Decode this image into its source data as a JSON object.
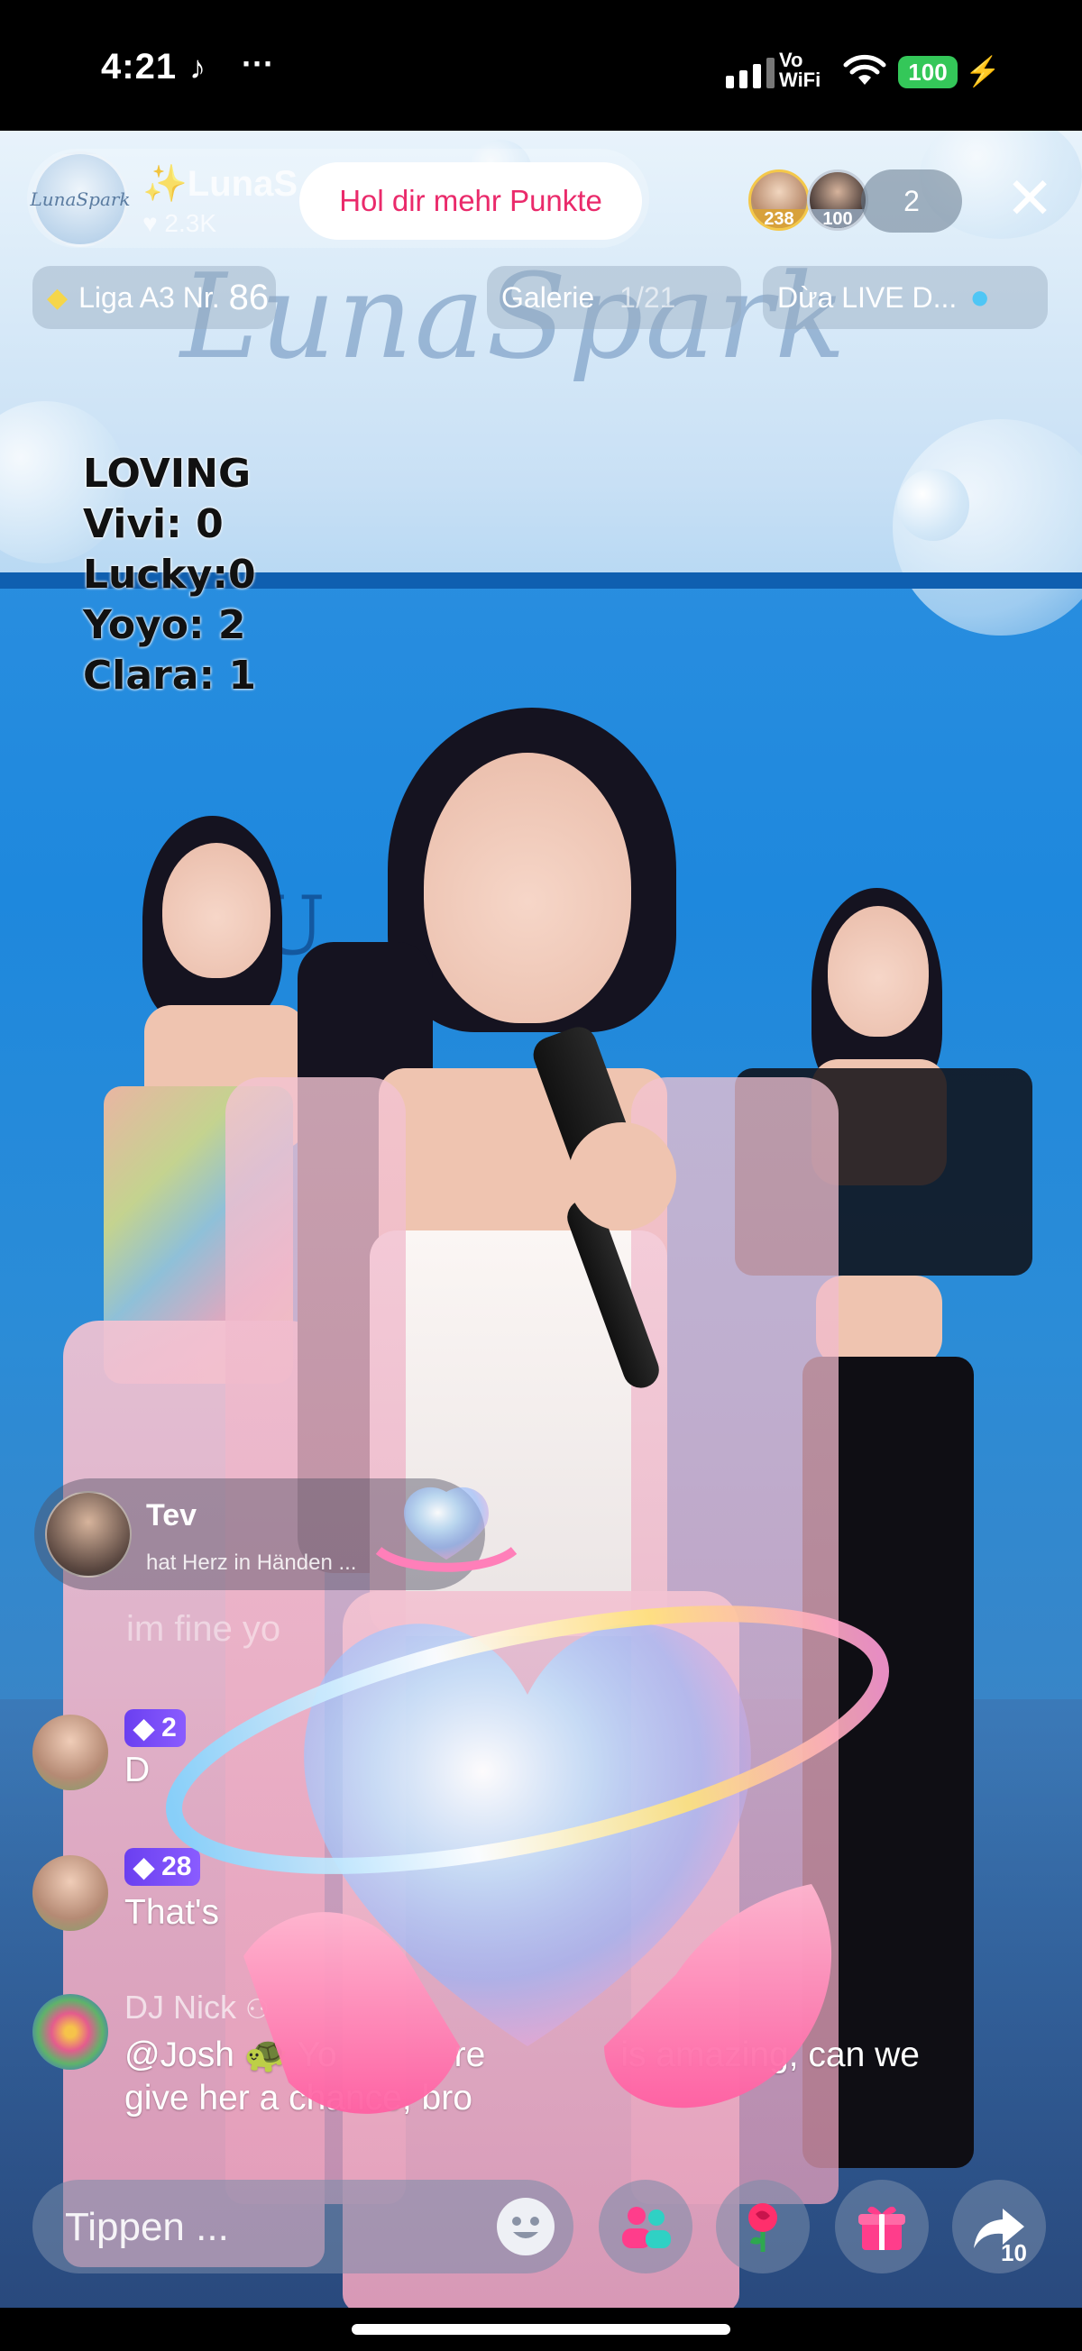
{
  "status_bar": {
    "time": "4:21",
    "tiktok_glyph": "♪",
    "dots": "···",
    "vowifi_line1": "Vo",
    "vowifi_line2": "WiFi",
    "battery": "100",
    "charging_glyph": "⚡"
  },
  "header": {
    "host_name": "✨LunaS",
    "host_likes": "♥ 2.3K",
    "host_avatar_text": "LunaSpark",
    "points_button": "Hol dir mehr Punkte",
    "viewers": [
      {
        "badge": "238"
      },
      {
        "badge": "100"
      }
    ],
    "viewer_count": "2",
    "close_glyph": "✕"
  },
  "chips": {
    "league_label": "Liga A3 Nr.",
    "league_number": "86",
    "gallery_label": "Galerie",
    "gallery_count": "1/21",
    "live_label": "Dừa LIVE D..."
  },
  "stage": {
    "watermark": "LunaSpark",
    "wall_logo": "U A"
  },
  "scoreboard": {
    "title": "LOVING",
    "rows": [
      {
        "label": "Vivi:",
        "value": "0"
      },
      {
        "label": "Lucky:",
        "value": "0"
      },
      {
        "label": "Yoyo:",
        "value": "2"
      },
      {
        "label": "Clara:",
        "value": "1"
      }
    ]
  },
  "gift_notice": {
    "name": "Tev",
    "text": "hat Herz in Händen ..."
  },
  "chat": {
    "ghost_line": "im fine yo",
    "messages": [
      {
        "badge": "2",
        "text": "D"
      },
      {
        "badge": "28",
        "text": "That's"
      },
      {
        "user": "DJ Nick",
        "text_line1": "@Josh 🐢 Yo",
        "text_mid": "re",
        "text_end": "is amazing, can we",
        "text_line2": "give her a chance, bro"
      }
    ]
  },
  "bottom_bar": {
    "input_placeholder": "Tippen ...",
    "share_count": "10"
  },
  "colors": {
    "accent_pink": "#ea2a6b",
    "badge_purple": "#7a4ff8",
    "battery_green": "#34c759"
  }
}
